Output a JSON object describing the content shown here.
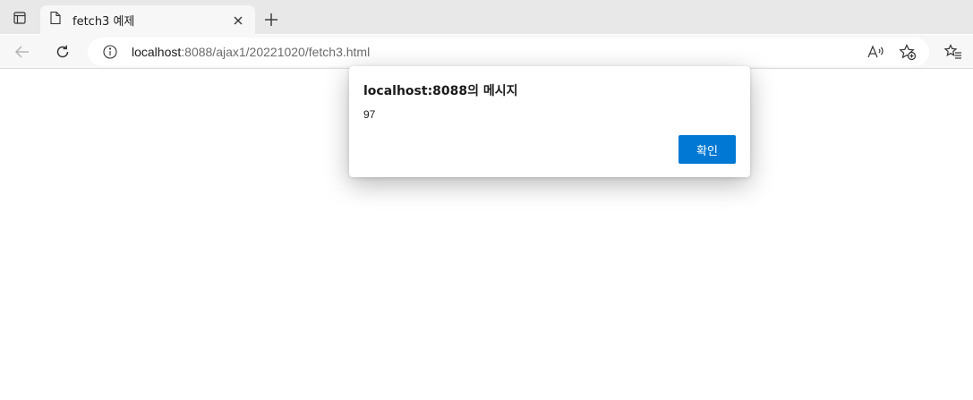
{
  "browser": {
    "tab": {
      "title": "fetch3 예제"
    },
    "address": {
      "host": "localhost",
      "rest": ":8088/ajax1/20221020/fetch3.html"
    },
    "icons": {
      "tab_actions": "tab-actions-icon",
      "page": "page-icon",
      "close": "close-icon",
      "new_tab": "plus-icon",
      "back": "back-arrow-icon",
      "refresh": "refresh-icon",
      "info": "info-icon",
      "read_aloud": "read-aloud-icon",
      "favorite": "favorite-add-icon",
      "favorites": "favorites-list-icon"
    }
  },
  "dialog": {
    "title": "localhost:8088의 메시지",
    "message": "97",
    "ok_label": "확인"
  },
  "colors": {
    "accent": "#0078d4",
    "tabstrip": "#e8e8e8",
    "toolbar": "#f7f7f7"
  }
}
